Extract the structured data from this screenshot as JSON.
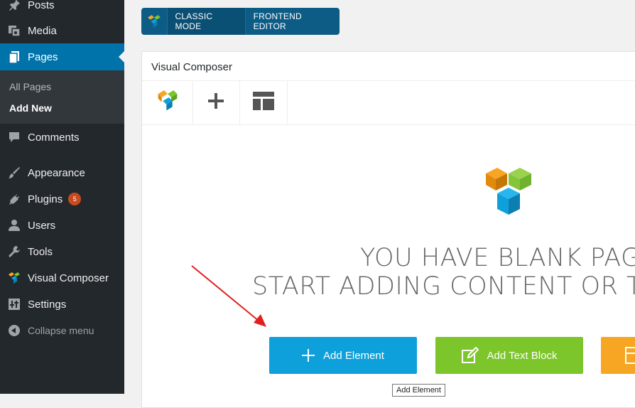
{
  "sidebar": {
    "items": [
      {
        "label": "Posts",
        "icon": "pin-icon"
      },
      {
        "label": "Media",
        "icon": "media-icon"
      },
      {
        "label": "Pages",
        "icon": "pages-icon"
      },
      {
        "label": "Comments",
        "icon": "comment-icon"
      },
      {
        "label": "Appearance",
        "icon": "brush-icon"
      },
      {
        "label": "Plugins",
        "icon": "plug-icon",
        "badge": "5"
      },
      {
        "label": "Users",
        "icon": "user-icon"
      },
      {
        "label": "Tools",
        "icon": "wrench-icon"
      },
      {
        "label": "Visual Composer",
        "icon": "vc-logo-icon"
      },
      {
        "label": "Settings",
        "icon": "settings-icon"
      }
    ],
    "submenu": [
      {
        "label": "All Pages"
      },
      {
        "label": "Add New"
      }
    ],
    "collapse_label": "Collapse menu"
  },
  "mode_bar": {
    "classic_label": "CLASSIC MODE",
    "frontend_label": "FRONTEND EDITOR"
  },
  "panel": {
    "title": "Visual Composer",
    "blank_line1": "YOU HAVE BLANK PAG",
    "blank_line2": "START ADDING CONTENT OR T",
    "add_element_label": "Add Element",
    "add_text_block_label": "Add Text Block",
    "tooltip": "Add Element"
  },
  "colors": {
    "sidebar_bg": "#23282d",
    "active_blue": "#0073aa",
    "vc_blue": "#0ea0db",
    "vc_green": "#7cc52a",
    "vc_orange": "#f6a623",
    "arrow_red": "#e02020"
  }
}
